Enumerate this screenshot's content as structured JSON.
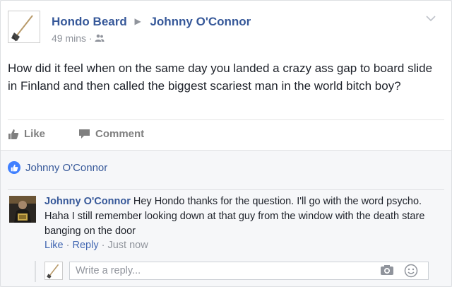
{
  "post": {
    "author": "Hondo Beard",
    "target": "Johnny O'Connor",
    "arrow": "▶",
    "time": "49 mins",
    "separator": " · ",
    "text": "How did it feel when on the same day you landed a crazy ass gap to board slide in Finland and then called the biggest scariest man in the world bitch boy?",
    "actions": {
      "like": "Like",
      "comment": "Comment"
    }
  },
  "likes": {
    "names": "Johnny O'Connor"
  },
  "comment": {
    "author": "Johnny O'Connor",
    "text": "Hey Hondo thanks for the question. I'll go with the word psycho. Haha I still remember looking down at that guy from the window with the death stare banging on the door",
    "like": "Like",
    "reply": "Reply",
    "time": "Just now",
    "sep": " · "
  },
  "reply_box": {
    "placeholder": "Write a reply..."
  },
  "colors": {
    "link": "#365899",
    "muted": "#90949c",
    "like_blue": "#4080ff",
    "panel_bg": "#f6f7f9"
  },
  "icons": [
    "broom-avatar",
    "friends-audience-icon",
    "chevron-down-icon",
    "thumbs-up-icon",
    "comment-icon",
    "camera-icon",
    "smiley-icon"
  ]
}
